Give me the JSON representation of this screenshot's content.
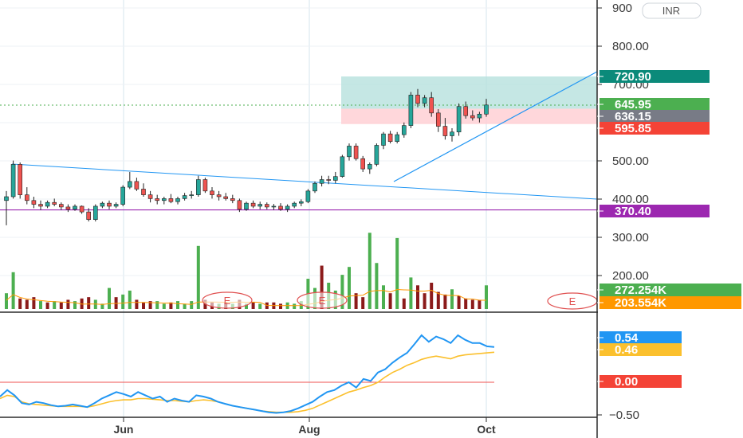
{
  "currency": "INR",
  "colors": {
    "up": "#26a69a",
    "down": "#ef5350",
    "vol_up": "#4caf50",
    "vol_down": "#8b1a1a",
    "target_zone": "#b2dfdb",
    "stop_zone": "#ffcdd2",
    "trendline": "#2196f3",
    "support": "#9c27b0",
    "osc_blue": "#2196f3",
    "osc_orange": "#fbc02d",
    "zero_line": "#ef5350",
    "vol_ma": "#ff9800",
    "grid": "#e6ecf2"
  },
  "chart_data": {
    "type": "candlestick",
    "price_axis": {
      "ticks": [
        "900",
        "800.00",
        "700.00",
        "500.00",
        "400.00",
        "300.00",
        "200.00"
      ],
      "range": [
        180,
        915
      ]
    },
    "oscillator_axis": {
      "ticks": [
        "−0.50"
      ],
      "range": [
        -0.55,
        0.75
      ]
    },
    "time_labels": [
      "Jun",
      "Aug",
      "Oct"
    ],
    "price_tags": [
      {
        "label": "720.90",
        "value": 720.9,
        "color": "#0b8a7a"
      },
      {
        "label": "645.95",
        "value": 645.95,
        "color": "#4caf50"
      },
      {
        "label": "636.15",
        "value": 636.15,
        "color": "#787b86"
      },
      {
        "label": "595.85",
        "value": 595.85,
        "color": "#f44336"
      },
      {
        "label": "370.40",
        "value": 370.4,
        "color": "#9c27b0"
      }
    ],
    "volume_tags": [
      {
        "label": "272.254K",
        "color": "#4caf50"
      },
      {
        "label": "203.554K",
        "color": "#ff9800"
      }
    ],
    "oscillator_tags": [
      {
        "label": "0.54",
        "value": 0.54,
        "color": "#2196f3"
      },
      {
        "label": "0.46",
        "value": 0.46,
        "color": "#fbc02d"
      },
      {
        "label": "0.00",
        "value": 0.0,
        "color": "#f44336"
      }
    ],
    "earnings_markers": [
      "E",
      "E",
      "E"
    ],
    "support_level": 370.4,
    "target_level": 720.9,
    "entry_level": 636.15,
    "stop_level": 595.85,
    "candles": [
      [
        395,
        420,
        330,
        405
      ],
      [
        405,
        500,
        400,
        490
      ],
      [
        490,
        495,
        400,
        410
      ],
      [
        410,
        430,
        385,
        395
      ],
      [
        395,
        405,
        375,
        385
      ],
      [
        385,
        395,
        370,
        380
      ],
      [
        380,
        395,
        375,
        390
      ],
      [
        390,
        400,
        380,
        385
      ],
      [
        385,
        390,
        370,
        378
      ],
      [
        378,
        385,
        365,
        372
      ],
      [
        372,
        385,
        368,
        380
      ],
      [
        380,
        382,
        360,
        365
      ],
      [
        365,
        375,
        340,
        345
      ],
      [
        345,
        385,
        340,
        380
      ],
      [
        380,
        392,
        375,
        388
      ],
      [
        388,
        395,
        372,
        380
      ],
      [
        380,
        390,
        375,
        385
      ],
      [
        385,
        435,
        380,
        430
      ],
      [
        430,
        470,
        425,
        445
      ],
      [
        445,
        455,
        420,
        425
      ],
      [
        425,
        440,
        405,
        410
      ],
      [
        410,
        420,
        390,
        400
      ],
      [
        400,
        410,
        385,
        395
      ],
      [
        395,
        405,
        385,
        400
      ],
      [
        400,
        412,
        388,
        392
      ],
      [
        392,
        405,
        385,
        400
      ],
      [
        400,
        415,
        395,
        408
      ],
      [
        408,
        420,
        400,
        410
      ],
      [
        410,
        460,
        405,
        450
      ],
      [
        450,
        455,
        415,
        420
      ],
      [
        420,
        430,
        400,
        410
      ],
      [
        410,
        420,
        395,
        405
      ],
      [
        405,
        415,
        395,
        400
      ],
      [
        400,
        410,
        388,
        395
      ],
      [
        395,
        400,
        365,
        372
      ],
      [
        372,
        392,
        368,
        388
      ],
      [
        388,
        395,
        375,
        380
      ],
      [
        380,
        392,
        372,
        385
      ],
      [
        385,
        390,
        372,
        378
      ],
      [
        378,
        386,
        370,
        380
      ],
      [
        380,
        388,
        368,
        372
      ],
      [
        372,
        385,
        365,
        380
      ],
      [
        380,
        392,
        375,
        388
      ],
      [
        388,
        398,
        380,
        392
      ],
      [
        392,
        425,
        388,
        420
      ],
      [
        420,
        445,
        415,
        440
      ],
      [
        440,
        460,
        432,
        450
      ],
      [
        450,
        460,
        438,
        448
      ],
      [
        448,
        470,
        440,
        458
      ],
      [
        458,
        515,
        455,
        510
      ],
      [
        510,
        545,
        500,
        538
      ],
      [
        538,
        545,
        500,
        505
      ],
      [
        505,
        512,
        470,
        478
      ],
      [
        478,
        495,
        465,
        490
      ],
      [
        490,
        545,
        485,
        540
      ],
      [
        540,
        575,
        530,
        570
      ],
      [
        570,
        578,
        545,
        550
      ],
      [
        550,
        575,
        545,
        568
      ],
      [
        568,
        600,
        560,
        592
      ],
      [
        592,
        680,
        585,
        672
      ],
      [
        672,
        688,
        640,
        650
      ],
      [
        650,
        672,
        640,
        665
      ],
      [
        665,
        680,
        615,
        625
      ],
      [
        625,
        635,
        575,
        590
      ],
      [
        590,
        612,
        555,
        565
      ],
      [
        565,
        585,
        550,
        575
      ],
      [
        575,
        650,
        565,
        642
      ],
      [
        642,
        655,
        610,
        618
      ],
      [
        618,
        632,
        605,
        612
      ],
      [
        612,
        628,
        600,
        622
      ],
      [
        622,
        662,
        615,
        646
      ]
    ],
    "volume": [
      [
        60,
        1
      ],
      [
        140,
        1
      ],
      [
        40,
        0
      ],
      [
        35,
        0
      ],
      [
        45,
        0
      ],
      [
        30,
        1
      ],
      [
        25,
        0
      ],
      [
        30,
        1
      ],
      [
        25,
        0
      ],
      [
        35,
        0
      ],
      [
        30,
        1
      ],
      [
        40,
        0
      ],
      [
        45,
        0
      ],
      [
        35,
        1
      ],
      [
        20,
        1
      ],
      [
        80,
        1
      ],
      [
        45,
        0
      ],
      [
        55,
        1
      ],
      [
        70,
        1
      ],
      [
        35,
        0
      ],
      [
        25,
        0
      ],
      [
        30,
        0
      ],
      [
        30,
        1
      ],
      [
        20,
        1
      ],
      [
        25,
        0
      ],
      [
        30,
        1
      ],
      [
        20,
        1
      ],
      [
        30,
        1
      ],
      [
        240,
        1
      ],
      [
        35,
        0
      ],
      [
        25,
        0
      ],
      [
        20,
        1
      ],
      [
        25,
        0
      ],
      [
        20,
        1
      ],
      [
        35,
        0
      ],
      [
        20,
        1
      ],
      [
        25,
        0
      ],
      [
        20,
        1
      ],
      [
        25,
        0
      ],
      [
        25,
        0
      ],
      [
        20,
        0
      ],
      [
        25,
        1
      ],
      [
        20,
        1
      ],
      [
        30,
        1
      ],
      [
        115,
        1
      ],
      [
        80,
        1
      ],
      [
        165,
        0
      ],
      [
        100,
        1
      ],
      [
        70,
        1
      ],
      [
        130,
        1
      ],
      [
        160,
        1
      ],
      [
        60,
        0
      ],
      [
        45,
        0
      ],
      [
        290,
        1
      ],
      [
        175,
        1
      ],
      [
        90,
        1
      ],
      [
        60,
        0
      ],
      [
        270,
        1
      ],
      [
        40,
        0
      ],
      [
        120,
        1
      ],
      [
        90,
        0
      ],
      [
        60,
        0
      ],
      [
        100,
        0
      ],
      [
        65,
        0
      ],
      [
        55,
        0
      ],
      [
        75,
        1
      ],
      [
        50,
        0
      ],
      [
        40,
        0
      ],
      [
        35,
        0
      ],
      [
        35,
        0
      ],
      [
        90,
        1
      ]
    ],
    "oscillator_blue": [
      -0.22,
      -0.12,
      -0.2,
      -0.32,
      -0.34,
      -0.3,
      -0.32,
      -0.35,
      -0.37,
      -0.36,
      -0.34,
      -0.36,
      -0.38,
      -0.32,
      -0.25,
      -0.2,
      -0.15,
      -0.18,
      -0.22,
      -0.15,
      -0.2,
      -0.25,
      -0.22,
      -0.3,
      -0.25,
      -0.28,
      -0.3,
      -0.2,
      -0.22,
      -0.25,
      -0.3,
      -0.33,
      -0.36,
      -0.38,
      -0.4,
      -0.42,
      -0.44,
      -0.46,
      -0.47,
      -0.46,
      -0.44,
      -0.4,
      -0.35,
      -0.3,
      -0.22,
      -0.15,
      -0.12,
      -0.05,
      0.0,
      -0.08,
      0.05,
      0.02,
      0.15,
      0.2,
      0.3,
      0.38,
      0.45,
      0.58,
      0.72,
      0.62,
      0.7,
      0.66,
      0.6,
      0.72,
      0.65,
      0.6,
      0.6,
      0.55,
      0.54
    ],
    "oscillator_orange": [
      -0.25,
      -0.2,
      -0.22,
      -0.3,
      -0.33,
      -0.34,
      -0.35,
      -0.36,
      -0.37,
      -0.37,
      -0.37,
      -0.37,
      -0.38,
      -0.36,
      -0.33,
      -0.3,
      -0.28,
      -0.27,
      -0.27,
      -0.25,
      -0.25,
      -0.26,
      -0.27,
      -0.28,
      -0.28,
      -0.29,
      -0.3,
      -0.28,
      -0.27,
      -0.28,
      -0.3,
      -0.33,
      -0.36,
      -0.38,
      -0.4,
      -0.42,
      -0.44,
      -0.45,
      -0.46,
      -0.46,
      -0.46,
      -0.45,
      -0.43,
      -0.4,
      -0.35,
      -0.3,
      -0.25,
      -0.2,
      -0.15,
      -0.12,
      -0.08,
      -0.05,
      0.0,
      0.08,
      0.15,
      0.2,
      0.26,
      0.3,
      0.35,
      0.38,
      0.4,
      0.38,
      0.36,
      0.4,
      0.42,
      0.43,
      0.44,
      0.45,
      0.46
    ]
  }
}
